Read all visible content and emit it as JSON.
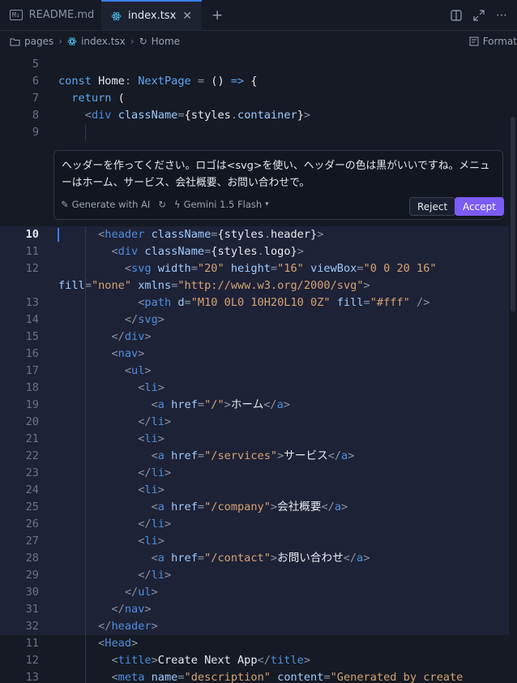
{
  "tabs": [
    {
      "label": "README.md",
      "icon": "markdown-icon"
    },
    {
      "label": "index.tsx",
      "icon": "react-icon",
      "active": true
    }
  ],
  "breadcrumb": {
    "items": [
      "pages",
      "index.tsx",
      "Home"
    ],
    "format_label": "Format"
  },
  "ai_panel": {
    "prompt": "ヘッダーを作ってください。ロゴは<svg>を使い、ヘッダーの色は黒がいいですね。メニューはホーム、サービス、会社概要、お問い合わせで。",
    "generate_label": "Generate with AI",
    "model_label": "Gemini 1.5 Flash",
    "reject_label": "Reject",
    "accept_label": "Accept"
  },
  "code_lines": [
    {
      "n": "5",
      "html": ""
    },
    {
      "n": "6",
      "html": "<span class='kw'>const</span> <span class='plain'>Home</span><span class='pun'>:</span> <span class='kw'>NextPage</span> <span class='pun'>=</span> <span class='plain'>()</span> <span class='kw'>=&gt;</span> <span class='plain'>{</span>"
    },
    {
      "n": "7",
      "html": "  <span class='kw'>return</span> <span class='plain'>(</span>"
    },
    {
      "n": "8",
      "html": "    <span class='pun'>&lt;</span><span class='tag'>div</span> <span class='attr'>className</span><span class='pun'>=</span><span class='plain'>{styles</span><span class='pun'>.</span><span class='attr'>container</span><span class='plain'>}</span><span class='pun'>&gt;</span>"
    },
    {
      "n": "9",
      "html": ""
    }
  ],
  "generated_lines": [
    {
      "n": "10",
      "html": "      <span class='pun'>&lt;</span><span class='tag'>header</span> <span class='attr'>className</span><span class='pun'>=</span><span class='plain'>{styles</span><span class='pun'>.</span><span class='plain'>header}</span><span class='pun'>&gt;</span>"
    },
    {
      "n": "11",
      "html": "        <span class='pun'>&lt;</span><span class='tag'>div</span> <span class='attr'>className</span><span class='pun'>=</span><span class='plain'>{styles</span><span class='pun'>.</span><span class='plain'>logo}</span><span class='pun'>&gt;</span>"
    },
    {
      "n": "12",
      "html": "          <span class='pun'>&lt;</span><span class='tag'>svg</span> <span class='attr'>width</span><span class='pun'>=</span><span class='str'>\"20\"</span> <span class='attr'>height</span><span class='pun'>=</span><span class='str'>\"16\"</span> <span class='attr'>viewBox</span><span class='pun'>=</span><span class='str'>\"0 0 20 16\"</span>"
    },
    {
      "n": "",
      "html": "<span class='attr'>fill</span><span class='pun'>=</span><span class='str'>\"none\"</span> <span class='attr'>xmlns</span><span class='pun'>=</span><span class='str'>\"http://www.w3.org/2000/svg\"</span><span class='pun'>&gt;</span>"
    },
    {
      "n": "13",
      "html": "            <span class='pun'>&lt;</span><span class='tag'>path</span> <span class='attr'>d</span><span class='pun'>=</span><span class='str'>\"M10 0L0 10H20L10 0Z\"</span> <span class='attr'>fill</span><span class='pun'>=</span><span class='str'>\"#fff\"</span> <span class='pun'>/&gt;</span>"
    },
    {
      "n": "14",
      "html": "          <span class='pun'>&lt;/</span><span class='tag'>svg</span><span class='pun'>&gt;</span>"
    },
    {
      "n": "15",
      "html": "        <span class='pun'>&lt;/</span><span class='tag'>div</span><span class='pun'>&gt;</span>"
    },
    {
      "n": "16",
      "html": "        <span class='pun'>&lt;</span><span class='tag'>nav</span><span class='pun'>&gt;</span>"
    },
    {
      "n": "17",
      "html": "          <span class='pun'>&lt;</span><span class='tag'>ul</span><span class='pun'>&gt;</span>"
    },
    {
      "n": "18",
      "html": "            <span class='pun'>&lt;</span><span class='tag'>li</span><span class='pun'>&gt;</span>"
    },
    {
      "n": "19",
      "html": "              <span class='pun'>&lt;</span><span class='tag'>a</span> <span class='attr'>href</span><span class='pun'>=</span><span class='str'>\"/\"</span><span class='pun'>&gt;</span><span class='plain'>ホーム</span><span class='pun'>&lt;/</span><span class='tag'>a</span><span class='pun'>&gt;</span>"
    },
    {
      "n": "20",
      "html": "            <span class='pun'>&lt;/</span><span class='tag'>li</span><span class='pun'>&gt;</span>"
    },
    {
      "n": "21",
      "html": "            <span class='pun'>&lt;</span><span class='tag'>li</span><span class='pun'>&gt;</span>"
    },
    {
      "n": "22",
      "html": "              <span class='pun'>&lt;</span><span class='tag'>a</span> <span class='attr'>href</span><span class='pun'>=</span><span class='str'>\"/services\"</span><span class='pun'>&gt;</span><span class='plain'>サービス</span><span class='pun'>&lt;/</span><span class='tag'>a</span><span class='pun'>&gt;</span>"
    },
    {
      "n": "23",
      "html": "            <span class='pun'>&lt;/</span><span class='tag'>li</span><span class='pun'>&gt;</span>"
    },
    {
      "n": "24",
      "html": "            <span class='pun'>&lt;</span><span class='tag'>li</span><span class='pun'>&gt;</span>"
    },
    {
      "n": "25",
      "html": "              <span class='pun'>&lt;</span><span class='tag'>a</span> <span class='attr'>href</span><span class='pun'>=</span><span class='str'>\"/company\"</span><span class='pun'>&gt;</span><span class='plain'>会社概要</span><span class='pun'>&lt;/</span><span class='tag'>a</span><span class='pun'>&gt;</span>"
    },
    {
      "n": "26",
      "html": "            <span class='pun'>&lt;/</span><span class='tag'>li</span><span class='pun'>&gt;</span>"
    },
    {
      "n": "27",
      "html": "            <span class='pun'>&lt;</span><span class='tag'>li</span><span class='pun'>&gt;</span>"
    },
    {
      "n": "28",
      "html": "              <span class='pun'>&lt;</span><span class='tag'>a</span> <span class='attr'>href</span><span class='pun'>=</span><span class='str'>\"/contact\"</span><span class='pun'>&gt;</span><span class='plain'>お問い合わせ</span><span class='pun'>&lt;/</span><span class='tag'>a</span><span class='pun'>&gt;</span>"
    },
    {
      "n": "29",
      "html": "            <span class='pun'>&lt;/</span><span class='tag'>li</span><span class='pun'>&gt;</span>"
    },
    {
      "n": "30",
      "html": "          <span class='pun'>&lt;/</span><span class='tag'>ul</span><span class='pun'>&gt;</span>"
    },
    {
      "n": "31",
      "html": "        <span class='pun'>&lt;/</span><span class='tag'>nav</span><span class='pun'>&gt;</span>"
    },
    {
      "n": "32",
      "html": "      <span class='pun'>&lt;/</span><span class='tag'>header</span><span class='pun'>&gt;</span>"
    }
  ],
  "tail_lines": [
    {
      "n": "11",
      "html": "      <span class='pun'>&lt;</span><span class='tag'>Head</span><span class='pun'>&gt;</span>"
    },
    {
      "n": "12",
      "html": "        <span class='pun'>&lt;</span><span class='tag'>title</span><span class='pun'>&gt;</span><span class='plain'>Create Next App</span><span class='pun'>&lt;/</span><span class='tag'>title</span><span class='pun'>&gt;</span>"
    },
    {
      "n": "13",
      "html": "        <span class='pun'>&lt;</span><span class='tag'>meta</span> <span class='attr'>name</span><span class='pun'>=</span><span class='str'>\"description\"</span> <span class='attr'>content</span><span class='pun'>=</span><span class='str'>\"Generated by create</span>"
    }
  ],
  "colors": {
    "accent": "#3b7ded",
    "accept": "#7b5cf5",
    "background": "#151a24"
  }
}
